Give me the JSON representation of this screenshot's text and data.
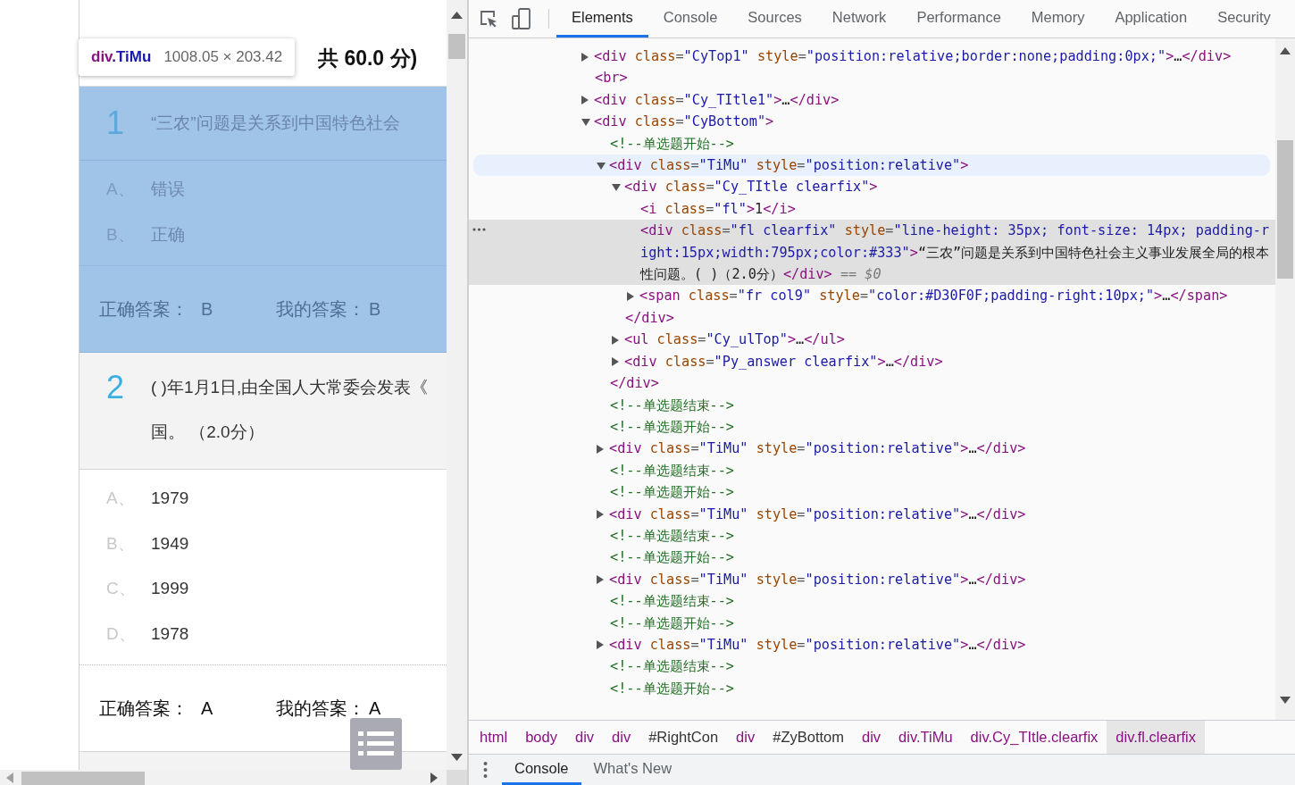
{
  "page": {
    "score_header": "共 60.0 分)",
    "inspect_tooltip": {
      "tag": "div",
      "class_name": ".TiMu",
      "size": "1008.05 × 203.42"
    },
    "questions": [
      {
        "number": "1",
        "highlighted": true,
        "lines": [
          "“三农”问题是关系到中国特色社会"
        ],
        "options": [
          {
            "letter": "A、",
            "text": "错误"
          },
          {
            "letter": "B、",
            "text": "正确"
          }
        ],
        "correct_label": "正确答案：",
        "correct": "B",
        "mine_label": "我的答案：",
        "mine": "B"
      },
      {
        "number": "2",
        "highlighted": false,
        "lines": [
          "( )年1月1日,由全国人大常委会发表《",
          "国。 （2.0分）"
        ],
        "options": [
          {
            "letter": "A、",
            "text": "1979"
          },
          {
            "letter": "B、",
            "text": "1949"
          },
          {
            "letter": "C、",
            "text": "1999"
          },
          {
            "letter": "D、",
            "text": "1978"
          }
        ],
        "correct_label": "正确答案：",
        "correct": "A",
        "mine_label": "我的答案：",
        "mine": "A"
      }
    ]
  },
  "devtools": {
    "tabs": [
      {
        "label": "Elements",
        "selected": true
      },
      {
        "label": "Console",
        "selected": false
      },
      {
        "label": "Sources",
        "selected": false
      },
      {
        "label": "Network",
        "selected": false
      },
      {
        "label": "Performance",
        "selected": false
      },
      {
        "label": "Memory",
        "selected": false
      },
      {
        "label": "Application",
        "selected": false
      },
      {
        "label": "Security",
        "selected": false
      }
    ],
    "tree": [
      {
        "kind": "collapsed",
        "text": "<div class=\"CyTop1\" style=\"position:relative;border:none;padding:0px;\">…</div>",
        "selected": false,
        "hovered": false
      },
      {
        "kind": "leaf",
        "text": "<br>",
        "selected": false,
        "hovered": false
      },
      {
        "kind": "collapsed",
        "text": "<div class=\"Cy_TItle1\">…</div>",
        "selected": false,
        "hovered": false
      },
      {
        "kind": "expanded",
        "text": "<div class=\"CyBottom\">",
        "selected": false,
        "hovered": false,
        "children": [
          {
            "kind": "leaf",
            "text": "<!--单选题开始-->",
            "selected": false,
            "hovered": false
          },
          {
            "kind": "expanded",
            "text": "<div class=\"TiMu\" style=\"position:relative\">",
            "selected": false,
            "hovered": true,
            "children": [
              {
                "kind": "expanded",
                "text": "<div class=\"Cy_TItle clearfix\">",
                "selected": false,
                "hovered": false,
                "children": [
                  {
                    "kind": "leaf",
                    "text": "<i class=\"fl\">1</i>",
                    "selected": false,
                    "hovered": false
                  },
                  {
                    "kind": "leaf",
                    "text": "<div class=\"fl clearfix\" style=\"line-height: 35px; font-size: 14px; padding-right:15px;width:795px;color:#333\">“三农”问题是关系到中国特色社会主义事业发展全局的根本性问题。( )（2.0分）</div>",
                    "selected": true,
                    "hovered": false
                  },
                  {
                    "kind": "collapsed",
                    "text": "<span class=\"fr col9\" style=\"color:#D30F0F;padding-right:10px;\">…</span>",
                    "selected": false,
                    "hovered": false
                  },
                  {
                    "kind": "close",
                    "text": "</div>",
                    "selected": false,
                    "hovered": false
                  }
                ]
              },
              {
                "kind": "collapsed",
                "text": "<ul class=\"Cy_ulTop\">…</ul>",
                "selected": false,
                "hovered": false
              },
              {
                "kind": "collapsed",
                "text": "<div class=\"Py_answer clearfix\">…</div>",
                "selected": false,
                "hovered": false
              },
              {
                "kind": "close",
                "text": "</div>",
                "selected": false,
                "hovered": false
              }
            ]
          },
          {
            "kind": "leaf",
            "text": "<!--单选题结束-->",
            "selected": false,
            "hovered": false
          },
          {
            "kind": "leaf",
            "text": "<!--单选题开始-->",
            "selected": false,
            "hovered": false
          },
          {
            "kind": "collapsed",
            "text": "<div class=\"TiMu\" style=\"position:relative\">…</div>",
            "selected": false,
            "hovered": false
          },
          {
            "kind": "leaf",
            "text": "<!--单选题结束-->",
            "selected": false,
            "hovered": false
          },
          {
            "kind": "leaf",
            "text": "<!--单选题开始-->",
            "selected": false,
            "hovered": false
          },
          {
            "kind": "collapsed",
            "text": "<div class=\"TiMu\" style=\"position:relative\">…</div>",
            "selected": false,
            "hovered": false
          },
          {
            "kind": "leaf",
            "text": "<!--单选题结束-->",
            "selected": false,
            "hovered": false
          },
          {
            "kind": "leaf",
            "text": "<!--单选题开始-->",
            "selected": false,
            "hovered": false
          },
          {
            "kind": "collapsed",
            "text": "<div class=\"TiMu\" style=\"position:relative\">…</div>",
            "selected": false,
            "hovered": false
          },
          {
            "kind": "leaf",
            "text": "<!--单选题结束-->",
            "selected": false,
            "hovered": false
          },
          {
            "kind": "leaf",
            "text": "<!--单选题开始-->",
            "selected": false,
            "hovered": false
          },
          {
            "kind": "collapsed",
            "text": "<div class=\"TiMu\" style=\"position:relative\">…</div>",
            "selected": false,
            "hovered": false
          },
          {
            "kind": "leaf",
            "text": "<!--单选题结束-->",
            "selected": false,
            "hovered": false
          },
          {
            "kind": "leaf",
            "text": "<!--单选题开始-->",
            "selected": false,
            "hovered": false
          }
        ]
      }
    ],
    "console_ref": "== $0",
    "breadcrumbs": [
      {
        "label": "html",
        "kind": "tag",
        "selected": false
      },
      {
        "label": "body",
        "kind": "tag",
        "selected": false
      },
      {
        "label": "div",
        "kind": "tag",
        "selected": false
      },
      {
        "label": "div",
        "kind": "tag",
        "selected": false
      },
      {
        "label": "#RightCon",
        "kind": "id",
        "selected": false
      },
      {
        "label": "div",
        "kind": "tag",
        "selected": false
      },
      {
        "label": "#ZyBottom",
        "kind": "id",
        "selected": false
      },
      {
        "label": "div",
        "kind": "tag",
        "selected": false
      },
      {
        "label": "div.TiMu",
        "kind": "tag",
        "selected": false
      },
      {
        "label": "div.Cy_TItle.clearfix",
        "kind": "tag",
        "selected": false
      },
      {
        "label": "div.fl.clearfix",
        "kind": "tag",
        "selected": true
      }
    ],
    "drawer_tabs": [
      {
        "label": "Console",
        "selected": true
      },
      {
        "label": "What's New",
        "selected": false
      }
    ]
  }
}
